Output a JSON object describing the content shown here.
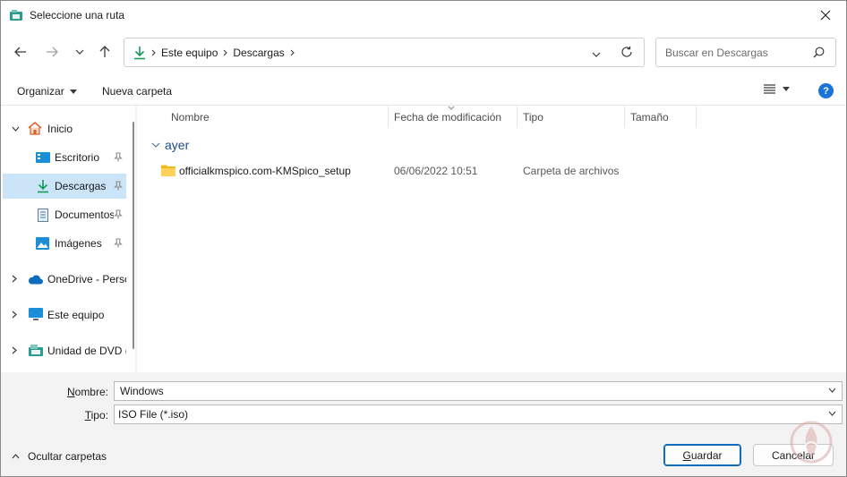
{
  "window": {
    "title": "Seleccione una ruta"
  },
  "address": {
    "crumbs": [
      "Este equipo",
      "Descargas"
    ]
  },
  "search": {
    "placeholder": "Buscar en Descargas"
  },
  "toolbar": {
    "organize_label": "Organizar",
    "new_folder_label": "Nueva carpeta"
  },
  "nav": {
    "items": [
      {
        "label": "Inicio"
      },
      {
        "label": "Escritorio"
      },
      {
        "label": "Descargas"
      },
      {
        "label": "Documentos"
      },
      {
        "label": "Imágenes"
      },
      {
        "label": "OneDrive - Personal"
      },
      {
        "label": "Este equipo"
      },
      {
        "label": "Unidad de DVD ("
      }
    ]
  },
  "columns": {
    "name": "Nombre",
    "modified": "Fecha de modificación",
    "type": "Tipo",
    "size": "Tamaño"
  },
  "groups": [
    {
      "label": "ayer",
      "files": [
        {
          "name": "officialkmspico.com-KMSpico_setup",
          "modified": "06/06/2022 10:51",
          "type": "Carpeta de archivos",
          "size": ""
        }
      ]
    }
  ],
  "form": {
    "name_label_prefix": "N",
    "name_label_rest": "ombre:",
    "name_value": "Windows",
    "type_label_prefix": "T",
    "type_label_rest": "ipo:",
    "type_value": "ISO File (*.iso)"
  },
  "footer": {
    "hide_folders_label": "Ocultar carpetas",
    "save_prefix": "G",
    "save_rest": "uardar",
    "cancel_label": "Cancelar"
  },
  "colors": {
    "accent": "#0f6cbd",
    "selected": "#cce4f7",
    "download_green": "#0f9d58"
  }
}
